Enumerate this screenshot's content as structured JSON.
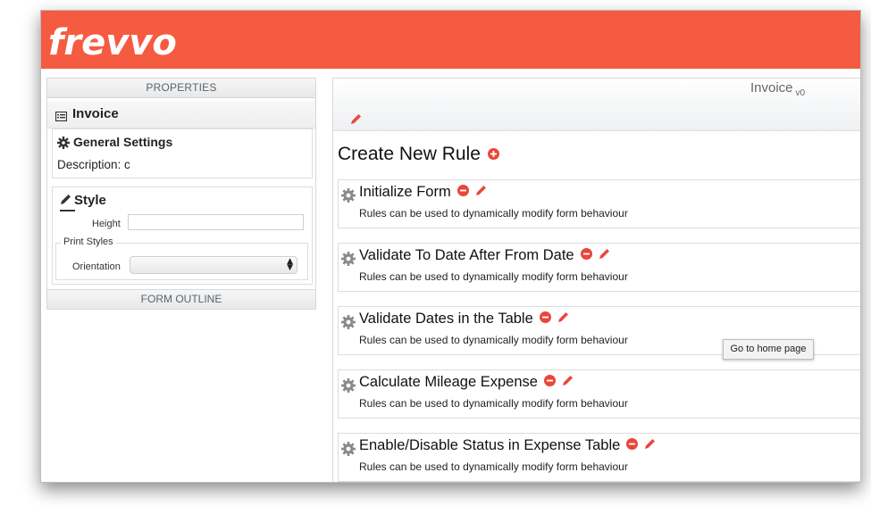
{
  "brand": {
    "logo_text": "frevvo",
    "header_color": "#f55b40"
  },
  "left_panel": {
    "properties_title": "PROPERTIES",
    "form_name": "Invoice",
    "general_settings": {
      "title": "General Settings",
      "description_label": "Description:",
      "description_value": "c"
    },
    "style": {
      "title": "Style",
      "height_label": "Height",
      "height_value": "",
      "print_styles_legend": "Print Styles",
      "orientation_label": "Orientation",
      "orientation_value": ""
    },
    "form_outline_title": "FORM OUTLINE"
  },
  "right_panel": {
    "form_title": "Invoice",
    "form_version": "v0",
    "create_rule_title": "Create New Rule",
    "rules": [
      {
        "name": "Initialize Form",
        "description": "Rules can be used to dynamically modify form behaviour"
      },
      {
        "name": "Validate To Date After From Date",
        "description": "Rules can be used to dynamically modify form behaviour"
      },
      {
        "name": "Validate Dates in the Table",
        "description": "Rules can be used to dynamically modify form behaviour"
      },
      {
        "name": "Calculate Mileage Expense",
        "description": "Rules can be used to dynamically modify form behaviour"
      },
      {
        "name": "Enable/Disable Status in Expense Table",
        "description": "Rules can be used to dynamically modify form behaviour"
      }
    ]
  },
  "tooltip": {
    "text": "Go to home page"
  },
  "icons": {
    "form": "form-icon",
    "settings": "gear-icon",
    "style": "pencil-icon",
    "edit": "pencil-icon",
    "add": "plus-circle-icon",
    "delete": "minus-circle-icon",
    "rule": "gear-icon"
  },
  "colors": {
    "accent": "#f55b40",
    "action_icon": "#e8473a"
  }
}
